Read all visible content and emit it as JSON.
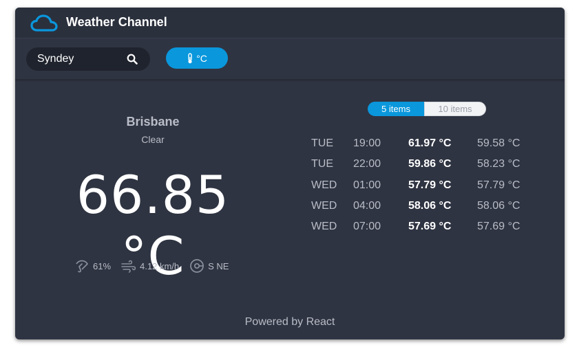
{
  "header": {
    "title": "Weather Channel",
    "logo_icon": "cloud-icon",
    "accent": "#0a97dc"
  },
  "toolbar": {
    "search_value": "Syndey",
    "unit_label": "°C"
  },
  "current": {
    "city": "Brisbane",
    "condition": "Clear",
    "temperature": "66.85 °C",
    "humidity": "61%",
    "wind_speed": "4.12 km/h",
    "wind_direction": "S NE"
  },
  "forecast_toggle": {
    "active": "5 items",
    "inactive": "10 items"
  },
  "forecast": [
    {
      "day": "TUE",
      "time": "19:00",
      "high": "61.97 °C",
      "low": "59.58 °C"
    },
    {
      "day": "TUE",
      "time": "22:00",
      "high": "59.86 °C",
      "low": "58.23 °C"
    },
    {
      "day": "WED",
      "time": "01:00",
      "high": "57.79 °C",
      "low": "57.79 °C"
    },
    {
      "day": "WED",
      "time": "04:00",
      "high": "58.06 °C",
      "low": "58.06 °C"
    },
    {
      "day": "WED",
      "time": "07:00",
      "high": "57.69 °C",
      "low": "57.69 °C"
    }
  ],
  "footer": {
    "text": "Powered by React"
  }
}
